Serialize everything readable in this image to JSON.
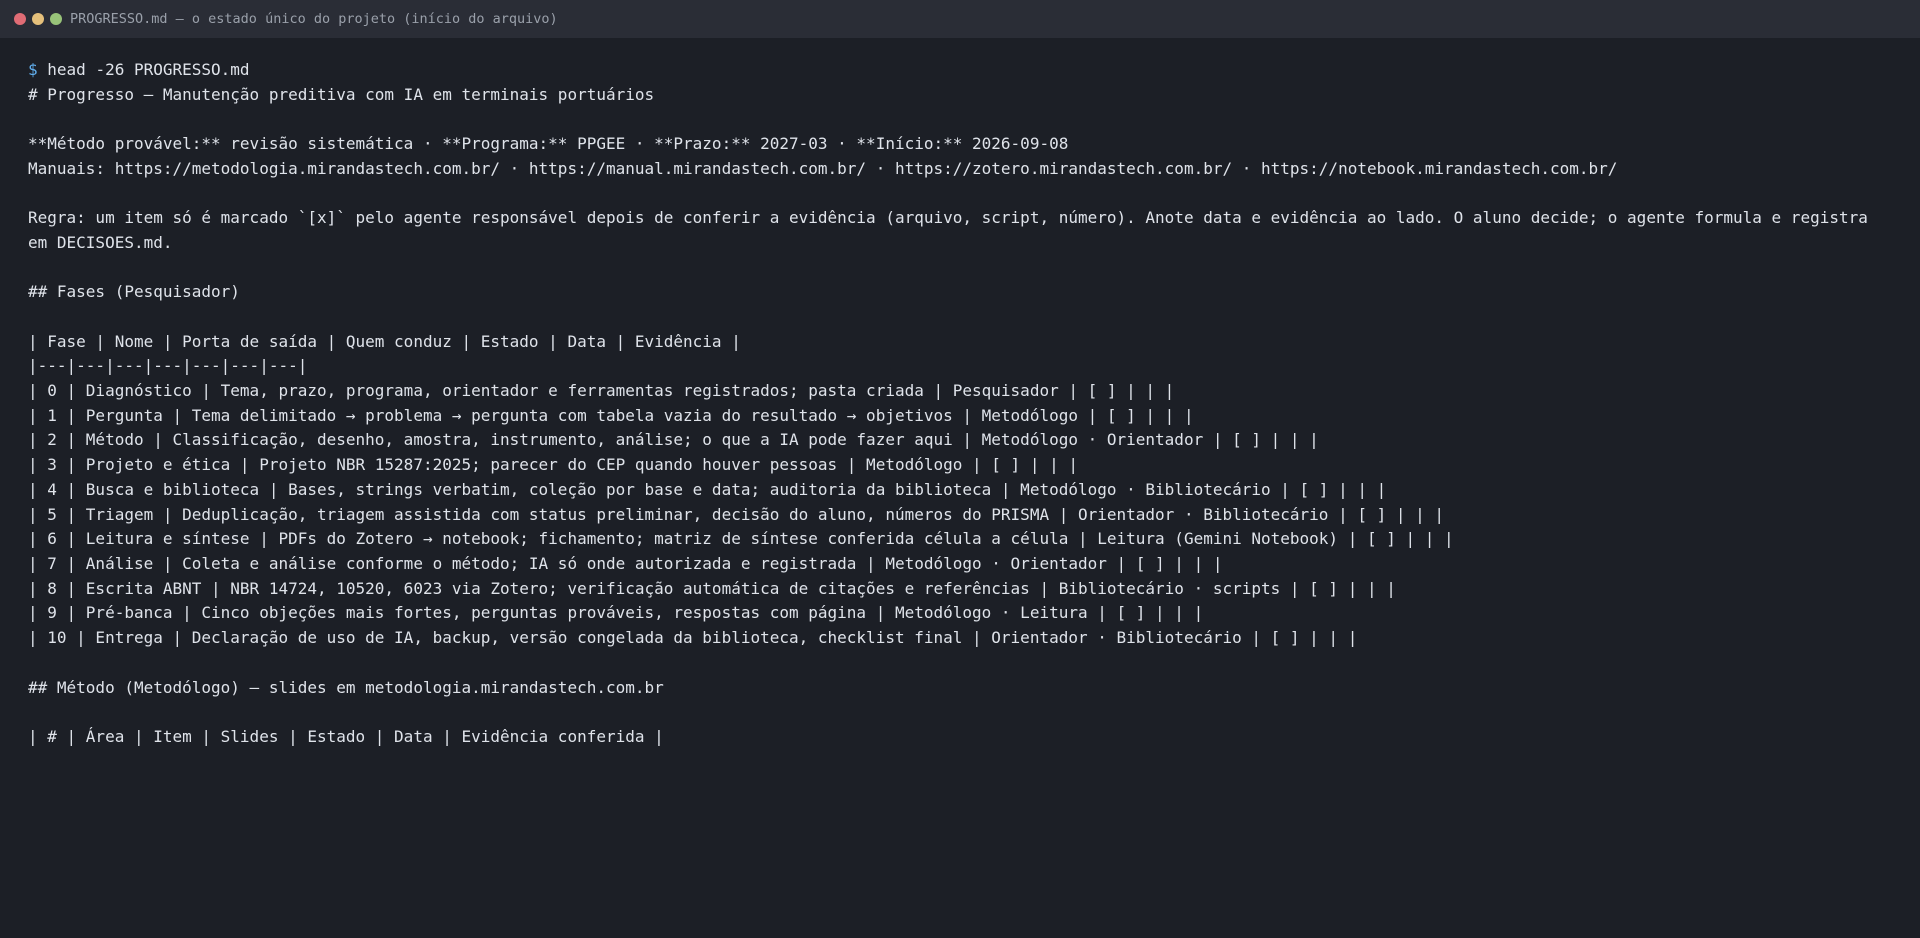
{
  "window": {
    "title": "PROGRESSO.md — o estado único do projeto (início do arquivo)"
  },
  "terminal": {
    "prompt_symbol": "$",
    "command": " head -26 PROGRESSO.md",
    "lines": [
      "# Progresso — Manutenção preditiva com IA em terminais portuários",
      "",
      "**Método provável:** revisão sistemática · **Programa:** PPGEE · **Prazo:** 2027-03 · **Início:** 2026-09-08",
      "Manuais: https://metodologia.mirandastech.com.br/ · https://manual.mirandastech.com.br/ · https://zotero.mirandastech.com.br/ · https://notebook.mirandastech.com.br/",
      "",
      "Regra: um item só é marcado `[x]` pelo agente responsável depois de conferir a evidência (arquivo, script, número). Anote data e evidência ao lado. O aluno decide; o agente formula e registra em DECISOES.md.",
      "",
      "## Fases (Pesquisador)",
      "",
      "| Fase | Nome | Porta de saída | Quem conduz | Estado | Data | Evidência |",
      "|---|---|---|---|---|---|---|",
      "| 0 | Diagnóstico | Tema, prazo, programa, orientador e ferramentas registrados; pasta criada | Pesquisador | [ ] | | |",
      "| 1 | Pergunta | Tema delimitado → problema → pergunta com tabela vazia do resultado → objetivos | Metodólogo | [ ] | | |",
      "| 2 | Método | Classificação, desenho, amostra, instrumento, análise; o que a IA pode fazer aqui | Metodólogo · Orientador | [ ] | | |",
      "| 3 | Projeto e ética | Projeto NBR 15287:2025; parecer do CEP quando houver pessoas | Metodólogo | [ ] | | |",
      "| 4 | Busca e biblioteca | Bases, strings verbatim, coleção por base e data; auditoria da biblioteca | Metodólogo · Bibliotecário | [ ] | | |",
      "| 5 | Triagem | Deduplicação, triagem assistida com status preliminar, decisão do aluno, números do PRISMA | Orientador · Bibliotecário | [ ] | | |",
      "| 6 | Leitura e síntese | PDFs do Zotero → notebook; fichamento; matriz de síntese conferida célula a célula | Leitura (Gemini Notebook) | [ ] | | |",
      "| 7 | Análise | Coleta e análise conforme o método; IA só onde autorizada e registrada | Metodólogo · Orientador | [ ] | | |",
      "| 8 | Escrita ABNT | NBR 14724, 10520, 6023 via Zotero; verificação automática de citações e referências | Bibliotecário · scripts | [ ] | | |",
      "| 9 | Pré-banca | Cinco objeções mais fortes, perguntas prováveis, respostas com página | Metodólogo · Leitura | [ ] | | |",
      "| 10 | Entrega | Declaração de uso de IA, backup, versão congelada da biblioteca, checklist final | Orientador · Bibliotecário | [ ] | | |",
      "",
      "## Método (Metodólogo) — slides em metodologia.mirandastech.com.br",
      "",
      "| # | Área | Item | Slides | Estado | Data | Evidência conferida |"
    ]
  },
  "colors": {
    "background": "#1c1f26",
    "titlebar": "#2a2d36",
    "text": "#dfe3ea",
    "prompt": "#61afef",
    "close": "#e06c75",
    "minimize": "#e5c07b",
    "maximize": "#98c379"
  }
}
